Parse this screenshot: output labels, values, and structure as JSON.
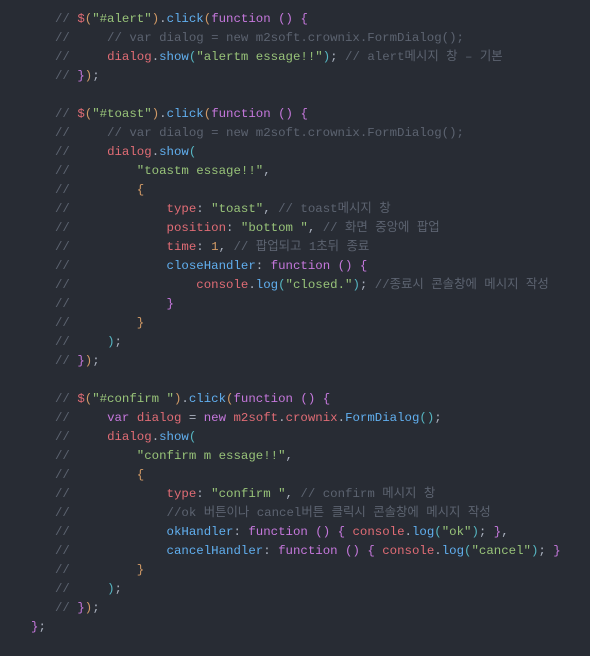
{
  "code": {
    "line1": "// $(\"#alert\").click(function () {",
    "line2": "//     // var dialog = new m2soft.crownix.FormDialog();",
    "line3": "//     dialog.show(\"alertm essage!!\"); // alert메시지 창 – 기본",
    "line4": "// });",
    "line5": "",
    "line6": "// $(\"#toast\").click(function () {",
    "line7": "//     // var dialog = new m2soft.crownix.FormDialog();",
    "line8": "//     dialog.show(",
    "line9": "//         \"toastm essage!!\",",
    "line10": "//         {",
    "line11": "//             type: \"toast\", // toast메시지 창",
    "line12": "//             position: \"bottom \", // 화면 중앙에 팝업",
    "line13": "//             time: 1, // 팝업되고 1초뒤 종료",
    "line14": "//             closeHandler: function () {",
    "line15": "//                 console.log(\"closed.\"); //종료시 콘솔창에 메시지 작성",
    "line16": "//             }",
    "line17": "//         }",
    "line18": "//     );",
    "line19": "// });",
    "line20": "",
    "line21": "// $(\"#confirm \").click(function () {",
    "line22": "//     var dialog = new m2soft.crownix.FormDialog();",
    "line23": "//     dialog.show(",
    "line24": "//         \"confirm m essage!!\",",
    "line25": "//         {",
    "line26": "//             type: \"confirm \", // confirm 메시지 창",
    "line27": "//             //ok 버튼이나 cancel버튼 클릭시 콘솔창에 메시지 작성",
    "line28": "//             okHandler: function () { console.log(\"ok\"); },",
    "line29": "//             cancelHandler: function () { console.log(\"cancel\"); }",
    "line30": "//         }",
    "line31": "//     );",
    "line32": "// });",
    "line33": "};",
    "line34": " "
  }
}
